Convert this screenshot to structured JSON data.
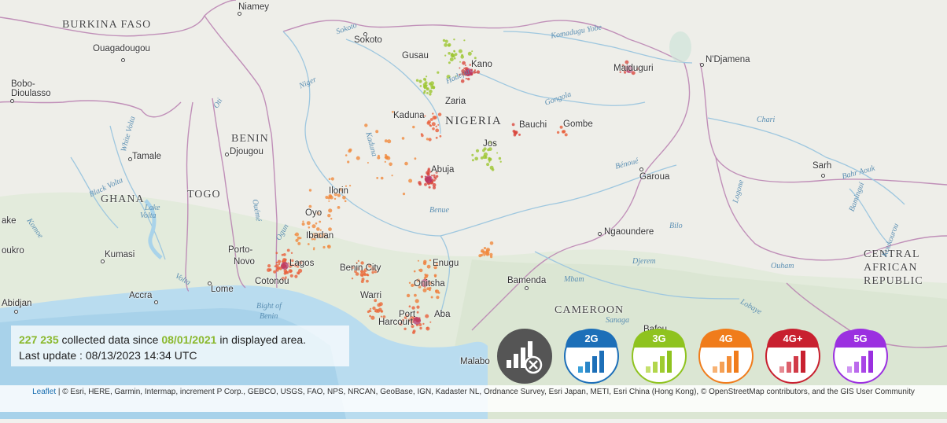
{
  "map": {
    "countries": {
      "burkina": "BURKINA FASO",
      "nigeria": "NIGERIA",
      "benin": "BENIN",
      "togo": "TOGO",
      "ghana": "GHANA",
      "cameroon": "CAMEROON",
      "car": [
        "CENTRAL",
        "AFRICAN",
        "REPUBLIC"
      ]
    },
    "cities": {
      "niamey": "Niamey",
      "ouagadougou": "Ouagadougou",
      "bobo": "Bobo-",
      "dioulasso": "Dioulasso",
      "tamale": "Tamale",
      "kumasi": "Kumasi",
      "accra": "Accra",
      "abidjan": "Abidjan",
      "ake": "ake",
      "oukro": "oukro",
      "djougou": "Djougou",
      "lome": "Lome",
      "porto": "Porto-",
      "novo": "Novo",
      "cotonou": "Cotonou",
      "sokoto": "Sokoto",
      "gusau": "Gusau",
      "kano": "Kano",
      "zaria": "Zaria",
      "kaduna": "Kaduna",
      "maiduguri": "Maiduguri",
      "ndjamena": "N'Djamena",
      "bauchi": "Bauchi",
      "gombe": "Gombe",
      "jos": "Jos",
      "abuja": "Abuja",
      "ilorin": "Ilorin",
      "oyo": "Oyo",
      "ibadan": "Ibadan",
      "lagos": "Lagos",
      "benin_city": "Benin City",
      "enugu": "Enugu",
      "onitsha": "Onitsha",
      "warri": "Warri",
      "port": "Port",
      "harcourt": "Harcourt",
      "aba": "Aba",
      "garoua": "Garoua",
      "ngaoundere": "Ngaoundere",
      "bamenda": "Bamenda",
      "malabo": "Malabo",
      "sarh": "Sarh",
      "bafoussam": "Bafou"
    },
    "water": {
      "komadugu": "Komadugu Yobe",
      "sokoto_r": "Sokoto",
      "niger": "Niger",
      "hadejia": "Hadejia",
      "gongola": "Gongola",
      "oti": "Oti",
      "white_volta": "White Volta",
      "black_volta": "Black Volta",
      "lake_volta": "Lake",
      "lake_volta2": "Volta",
      "kaduna_r": "Kaduna",
      "oueme": "Ouémé",
      "ogun": "Ogun",
      "benue": "Benue",
      "benoue": "Bénoué",
      "chari": "Chari",
      "bahr_aouk": "Bahr Aouk",
      "bamingui": "Bamingui",
      "logone": "Logone",
      "bilo": "Bilo",
      "djerem": "Djerem",
      "ouham": "Ouham",
      "mbam": "Mbam",
      "sanaga": "Sanaga",
      "lobaye": "Lobaye",
      "koukourou": "Koukourou",
      "komoe": "Komoe",
      "volta": "Volta",
      "bight": "Bight of",
      "benin_w": "Benin"
    }
  },
  "stats": {
    "count": "227 235",
    "text1": " collected data since ",
    "since": "08/01/2021",
    "text2": " in displayed area.",
    "update": "Last update : 08/13/2023 14:34 UTC"
  },
  "filters": [
    {
      "label": "",
      "color": "#555555",
      "icon": "no-network-icon"
    },
    {
      "label": "2G",
      "color": "#1d6fb8"
    },
    {
      "label": "3G",
      "color": "#8fc31f"
    },
    {
      "label": "4G",
      "color": "#f07c1b"
    },
    {
      "label": "4G+",
      "color": "#c8202f"
    },
    {
      "label": "5G",
      "color": "#9b30e0"
    }
  ],
  "attribution": {
    "leaflet": "Leaflet",
    "text": " | © Esri, HERE, Garmin, Intermap, increment P Corp., GEBCO, USGS, FAO, NPS, NRCAN, GeoBase, IGN, Kadaster NL, Ordnance Survey, Esri Japan, METI, Esri China (Hong Kong), © OpenStreetMap contributors, and the GIS User Community"
  }
}
